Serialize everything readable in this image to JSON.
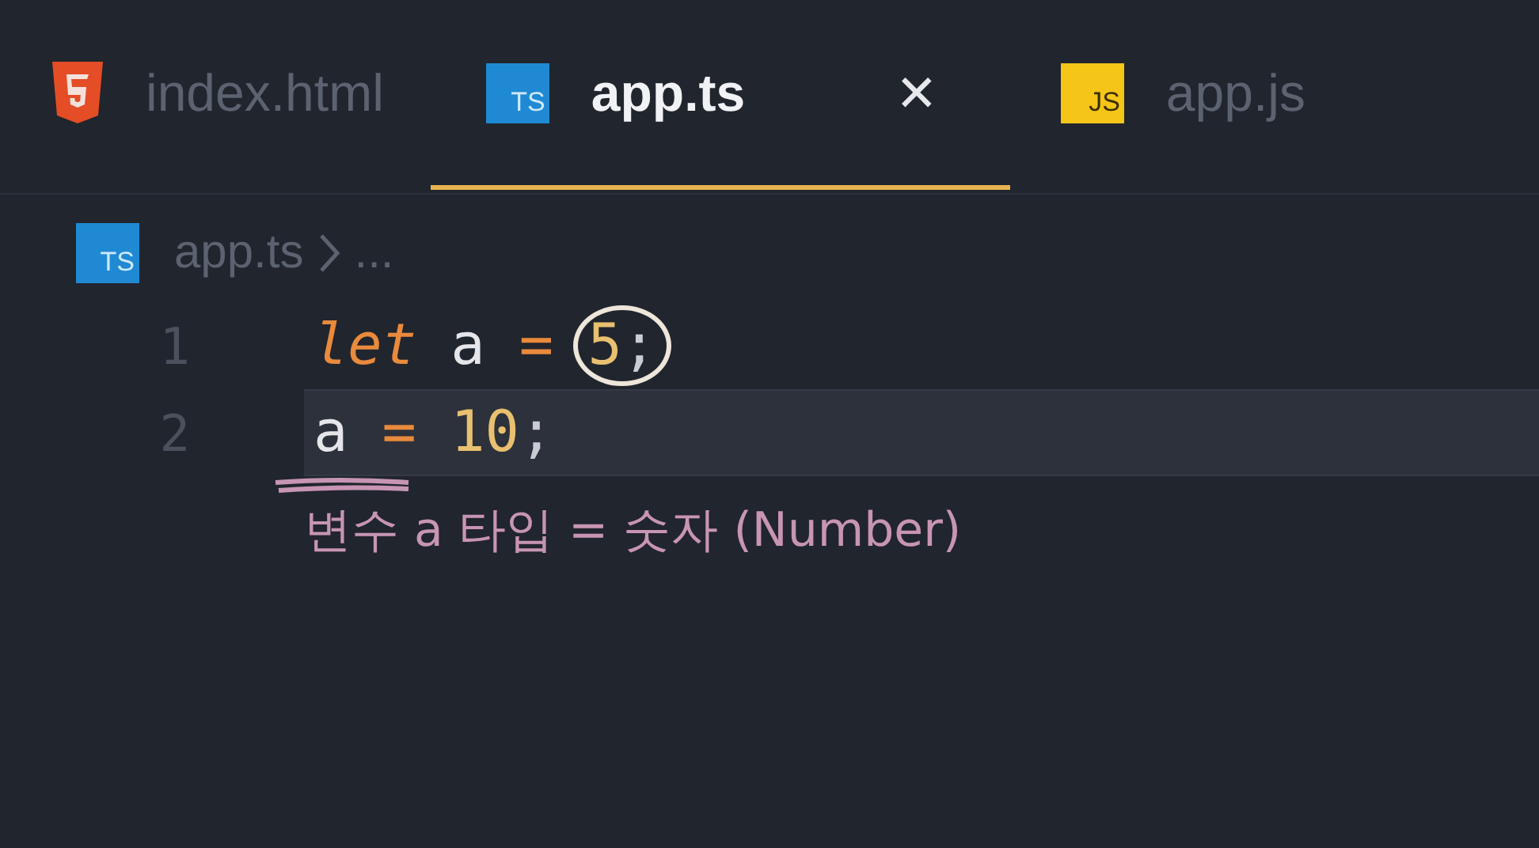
{
  "tabs": [
    {
      "kind": "html",
      "label": "index.html",
      "selected": false,
      "closable": false
    },
    {
      "kind": "ts",
      "badge": "TS",
      "label": "app.ts",
      "selected": true,
      "closable": true,
      "close_glyph": "✕"
    },
    {
      "kind": "js",
      "badge": "JS",
      "label": "app.js",
      "selected": false,
      "closable": false
    }
  ],
  "breadcrumb": {
    "kind": "ts",
    "badge": "TS",
    "file": "app.ts",
    "rest": "..."
  },
  "lines": [
    {
      "number": "1",
      "current": false,
      "tokens": [
        {
          "kind": "keyword",
          "text": "let",
          "space_after": true
        },
        {
          "kind": "identifier",
          "text": "a",
          "space_after": true
        },
        {
          "kind": "operator",
          "text": "=",
          "space_after": true
        },
        {
          "kind": "number",
          "text": "5",
          "circled": true
        },
        {
          "kind": "punct",
          "text": ";",
          "circled": true
        }
      ]
    },
    {
      "number": "2",
      "current": true,
      "tokens": [
        {
          "kind": "identifier",
          "text": "a",
          "underlined": true,
          "space_after": true
        },
        {
          "kind": "operator",
          "text": "=",
          "space_after": true
        },
        {
          "kind": "number",
          "text": "10"
        },
        {
          "kind": "punct",
          "text": ";"
        }
      ]
    }
  ],
  "note": "변수 a 타입 = 숫자 (Number)"
}
